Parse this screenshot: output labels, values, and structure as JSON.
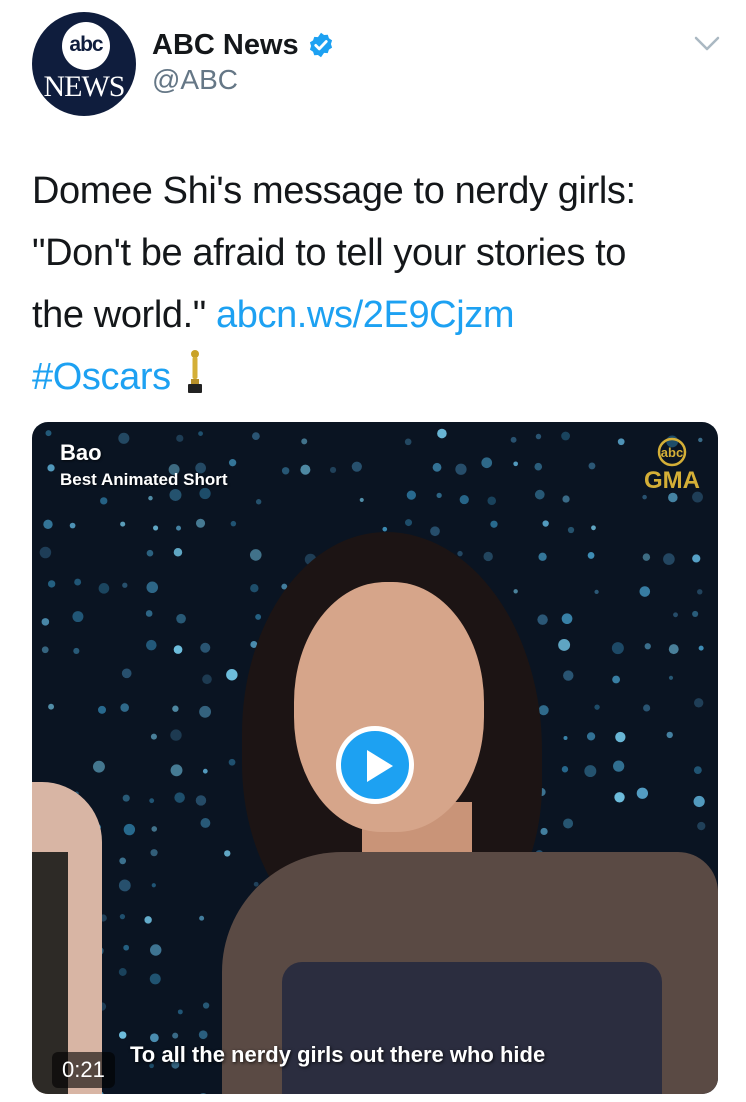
{
  "account": {
    "display_name": "ABC News",
    "handle": "@ABC",
    "avatar_top_text": "abc",
    "avatar_bottom_text": "NEWS",
    "verified": true
  },
  "tweet": {
    "line1": "Domee Shi's message to nerdy girls:",
    "line2": "\"Don't be afraid to tell your stories to",
    "line3_text": "the world.\" ",
    "link": "abcn.ws/2E9Cjzm",
    "hashtag": "#Oscars",
    "emoji_icon": "oscar-trophy"
  },
  "media": {
    "overlay_title": "Bao",
    "overlay_subtitle": "Best Animated Short",
    "brand_top": "abc",
    "brand_bottom": "GMA",
    "caption": "To all the nerdy girls out there who hide",
    "duration": "0:21",
    "play_icon": "play-icon"
  },
  "colors": {
    "link": "#1da1f2",
    "text": "#14171a",
    "secondary": "#657786",
    "verified": "#1da1f2"
  }
}
